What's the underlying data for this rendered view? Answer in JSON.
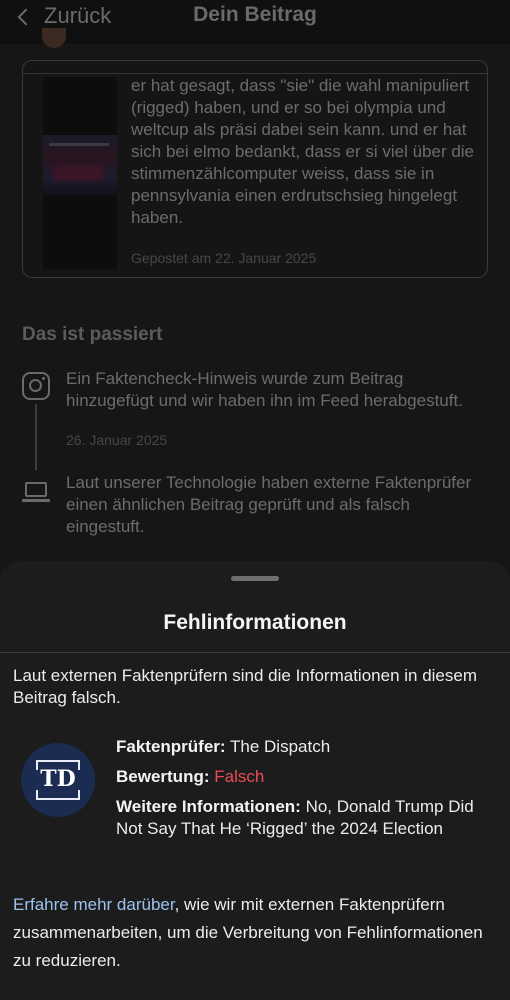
{
  "header": {
    "back_label": "Zurück",
    "title": "Dein Beitrag"
  },
  "post": {
    "text": "er hat gesagt, dass \"sie\" die wahl manipuliert (rigged) haben, und er so bei olympia und weltcup als präsi dabei sein kann. und er hat sich bei elmo bedankt, dass er si viel über die stimmenzählcomputer weiss, dass sie in pennsylvania einen erdrutschsieg hingelegt haben.",
    "date": "Gepostet am 22. Januar 2025"
  },
  "timeline": {
    "title": "Das ist passiert",
    "items": [
      {
        "icon": "instagram-icon",
        "text": "Ein Faktencheck-Hinweis wurde zum Beitrag hinzugefügt und wir haben ihn im Feed herabgestuft.",
        "date": "26. Januar 2025"
      },
      {
        "icon": "laptop-icon",
        "text": "Laut unserer Technologie haben externe Faktenprüfer einen ähnlichen Beitrag geprüft und als falsch eingestuft."
      }
    ]
  },
  "sheet": {
    "title": "Fehlinformationen",
    "intro": "Laut externen Faktenprüfern sind die Informationen in diesem Beitrag falsch.",
    "logo_text": "TD",
    "checker_label": "Faktenprüfer:",
    "checker_value": "The Dispatch",
    "rating_label": "Bewertung:",
    "rating_value": "Falsch",
    "more_label": "Weitere Informationen:",
    "more_value": "No, Donald Trump Did Not Say That He ‘Rigged’ the 2024 Election",
    "footer_link": "Erfahre mehr darüber",
    "footer_rest": ", wie wir mit externen Faktenprüfern zusammenarbeiten, um die Verbreitung von Fehlinformationen zu reduzieren."
  },
  "colors": {
    "false_red": "#ee4a55",
    "link_blue": "#9cc2f0",
    "logo_navy": "#1b2b52"
  }
}
